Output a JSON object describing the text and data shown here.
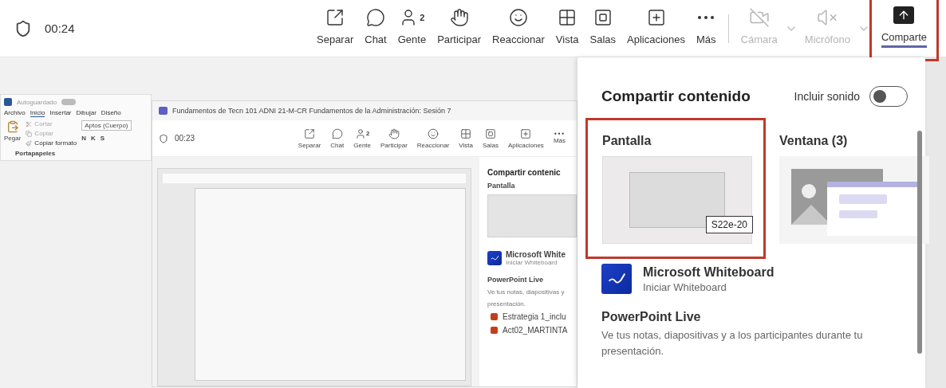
{
  "toolbar": {
    "timer": "00:24",
    "actions": [
      {
        "label": "Separar"
      },
      {
        "label": "Chat"
      },
      {
        "label": "Gente",
        "badge": "2"
      },
      {
        "label": "Participar"
      },
      {
        "label": "Reaccionar"
      },
      {
        "label": "Vista"
      },
      {
        "label": "Salas"
      },
      {
        "label": "Aplicaciones"
      },
      {
        "label": "Más"
      }
    ],
    "media": [
      {
        "label": "Cámara",
        "disabled": true,
        "dropdown": true,
        "selected": false,
        "highlighted": false
      },
      {
        "label": "Micrófono",
        "disabled": true,
        "dropdown": true,
        "selected": false,
        "highlighted": false
      },
      {
        "label": "Comparte",
        "disabled": false,
        "dropdown": false,
        "selected": true,
        "highlighted": true
      }
    ]
  },
  "shared_screen": {
    "word": {
      "autosave": "Autoguardado",
      "autosave_on": false,
      "tabs": [
        {
          "label": "Archivo",
          "selected": false
        },
        {
          "label": "Inicio",
          "selected": true
        },
        {
          "label": "Insertar",
          "selected": false
        },
        {
          "label": "Dibujar",
          "selected": false
        },
        {
          "label": "Diseño",
          "selected": false
        }
      ],
      "paste": "Pegar",
      "clipboard": [
        "Cortar",
        "Copiar",
        "Copiar formato"
      ],
      "group": "Portapapeles",
      "font": "Aptos (Cuerpo)",
      "format": [
        "N",
        "K",
        "S"
      ]
    },
    "meeting": {
      "title": "Fundamentos de Tecn 101 ADNI 21-M-CR Fundamentos de la Administración: Sesión 7",
      "timer": "00:23",
      "actions": [
        {
          "label": "Separar"
        },
        {
          "label": "Chat"
        },
        {
          "label": "Gente",
          "badge": "2"
        },
        {
          "label": "Participar"
        },
        {
          "label": "Reaccionar"
        },
        {
          "label": "Vista"
        },
        {
          "label": "Salas"
        },
        {
          "label": "Aplicaciones"
        },
        {
          "label": "Más"
        }
      ],
      "share_panel": {
        "title": "Compartir contenic",
        "screen": "Pantalla",
        "whiteboard": {
          "title": "Microsoft White",
          "subtitle": "Iniciar Whiteboard"
        },
        "powerpoint": {
          "title": "PowerPoint Live",
          "lines": [
            "Ve tus notas, diapositivas y",
            "presentación."
          ]
        },
        "files": [
          "Estrategia 1_inclu",
          "Act02_MARTINTA"
        ]
      }
    }
  },
  "share_panel": {
    "title": "Compartir contenido",
    "sound": {
      "label": "Incluir sonido",
      "on": false
    },
    "options": [
      {
        "label": "Pantalla",
        "highlighted": true,
        "tooltip": "S22e-20"
      },
      {
        "label": "Ventana (3)",
        "highlighted": false
      }
    ],
    "whiteboard": {
      "title": "Microsoft Whiteboard",
      "subtitle": "Iniciar Whiteboard"
    },
    "powerpoint": {
      "title": "PowerPoint Live",
      "description": "Ve tus notas, diapositivas y a los participantes durante tu presentación."
    }
  }
}
